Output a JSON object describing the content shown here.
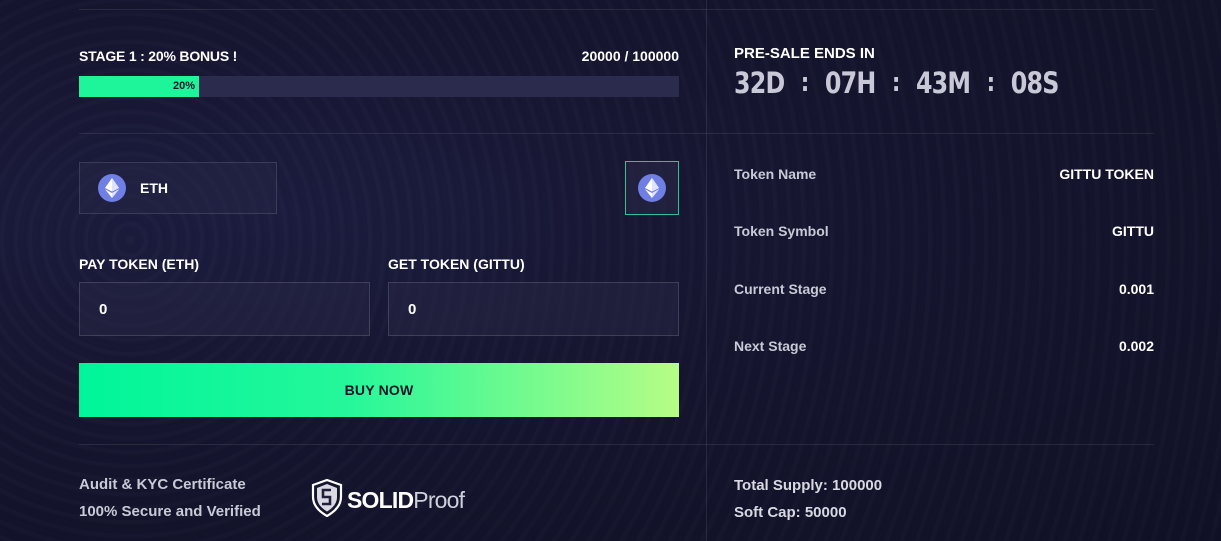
{
  "stage": {
    "title": "STAGE 1 : 20% BONUS !",
    "count": "20000 / 100000",
    "progress_label": "20%",
    "progress_fraction": 0.2
  },
  "presale": {
    "title": "PRE-SALE ENDS IN",
    "days": "32D",
    "hours": "07H",
    "minutes": "43M",
    "seconds": "08S",
    "separator": ":"
  },
  "currency": {
    "selected": "ETH",
    "icon": "ethereum-icon"
  },
  "pay_field": {
    "label": "PAY TOKEN (ETH)",
    "value": "0"
  },
  "get_field": {
    "label": "GET TOKEN (GITTU)",
    "value": "0"
  },
  "buy_button": {
    "label": "BUY NOW"
  },
  "token_info": [
    {
      "label": "Token Name",
      "value": "GITTU TOKEN"
    },
    {
      "label": "Token Symbol",
      "value": "GITTU"
    },
    {
      "label": "Current Stage",
      "value": "0.001"
    },
    {
      "label": "Next Stage",
      "value": "0.002"
    }
  ],
  "audit": {
    "line1": "Audit & KYC Certificate",
    "line2": "100% Secure and Verified",
    "logo_bold": "SOLID",
    "logo_light": "Proof"
  },
  "supply": {
    "total": "Total Supply: 100000",
    "soft_cap": "Soft Cap: 50000"
  },
  "colors": {
    "accent": "#1ef59a",
    "background": "#15152f",
    "eth_icon": "#6f7fe4",
    "gradient_end": "#b6fd85"
  }
}
